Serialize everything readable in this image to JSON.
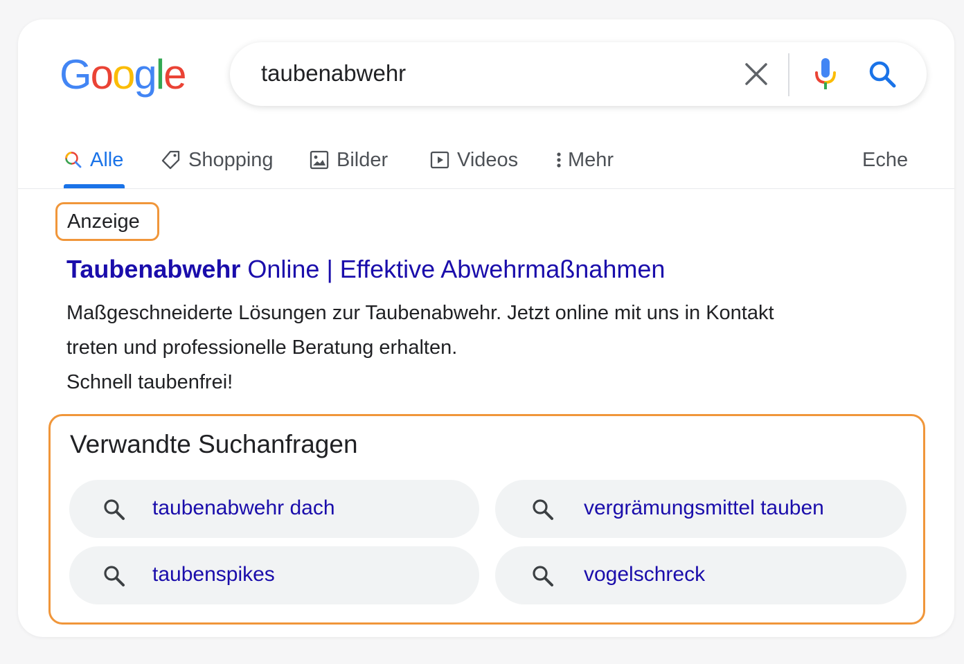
{
  "logo": {
    "letters": [
      "G",
      "o",
      "o",
      "g",
      "l",
      "e"
    ],
    "colors": [
      "#4285F4",
      "#EA4335",
      "#FBBC05",
      "#4285F4",
      "#34A853",
      "#EA4335"
    ]
  },
  "search": {
    "query": "taubenabwehr"
  },
  "tabs": [
    {
      "label": "Alle",
      "icon": "search-icon",
      "active": true
    },
    {
      "label": "Shopping",
      "icon": "tag-icon"
    },
    {
      "label": "Bilder",
      "icon": "image-icon"
    },
    {
      "label": "Videos",
      "icon": "play-icon"
    },
    {
      "label": "Mehr",
      "icon": "more-vert-icon"
    },
    {
      "label": "Eche"
    }
  ],
  "ad": {
    "label": "Anzeige",
    "title_bold": "Taubenabwehr",
    "title_rest": " Online | Effektive Abwehrmaßnahmen",
    "desc_line1": "Maßgeschneiderte Lösungen zur Taubenabwehr. Jetzt online mit uns  in Kontakt",
    "desc_line2": "treten und professionelle Beratung erhalten.",
    "desc_line3": "Schnell taubenfrei!"
  },
  "related": {
    "title": "Verwandte Suchanfragen",
    "items": [
      "taubenabwehr dach",
      "vergrämungsmittel tauben",
      "taubenspikes",
      "vogelschreck"
    ]
  },
  "colors": {
    "accent": "#1a73e8",
    "link": "#1a0dab",
    "highlight": "#f0963a"
  }
}
